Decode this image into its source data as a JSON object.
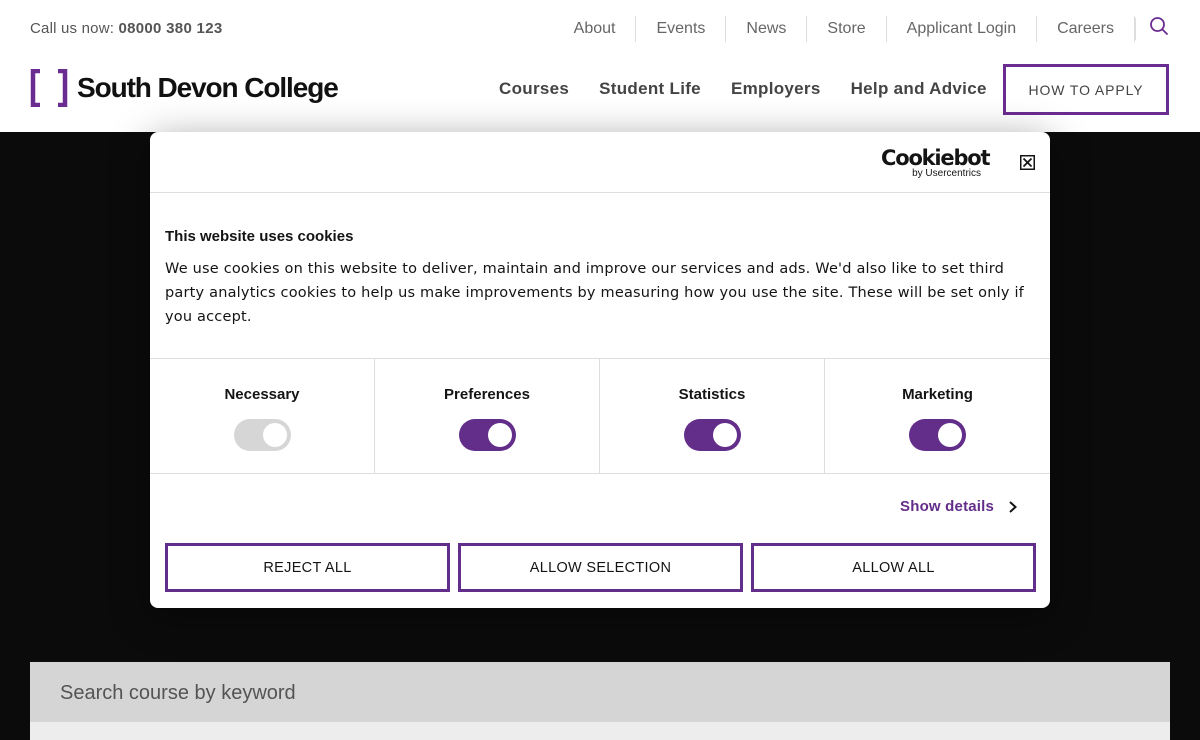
{
  "header": {
    "call_label": "Call us now:",
    "call_number": "08000 380 123",
    "top_nav": [
      "About",
      "Events",
      "News",
      "Store",
      "Applicant Login",
      "Careers"
    ],
    "search_icon": "search-icon",
    "logo_text": "South Devon College",
    "main_nav": [
      "Courses",
      "Student Life",
      "Employers",
      "Help and Advice"
    ],
    "apply_label": "HOW TO APPLY"
  },
  "colors": {
    "brand_purple": "#6b2c91",
    "dialog_purple": "#632d8a",
    "background": "#0b0b0b"
  },
  "cookie_dialog": {
    "brand_name": "Cookiebot",
    "brand_sub": "by Usercentrics",
    "close_icon": "close-icon",
    "title": "This website uses cookies",
    "description": "We use cookies on this website to deliver, maintain and improve our services and ads. We'd also like to set third party analytics cookies to help us make improvements by measuring how you use the site. These will be set only if you accept.",
    "categories": [
      {
        "label": "Necessary",
        "enabled": true,
        "disabled": true
      },
      {
        "label": "Preferences",
        "enabled": true,
        "disabled": false
      },
      {
        "label": "Statistics",
        "enabled": true,
        "disabled": false
      },
      {
        "label": "Marketing",
        "enabled": true,
        "disabled": false
      }
    ],
    "show_details_label": "Show details",
    "buttons": {
      "reject": "REJECT ALL",
      "selection": "ALLOW SELECTION",
      "allow": "ALLOW ALL"
    }
  },
  "course_search": {
    "placeholder": "Search course by keyword"
  }
}
